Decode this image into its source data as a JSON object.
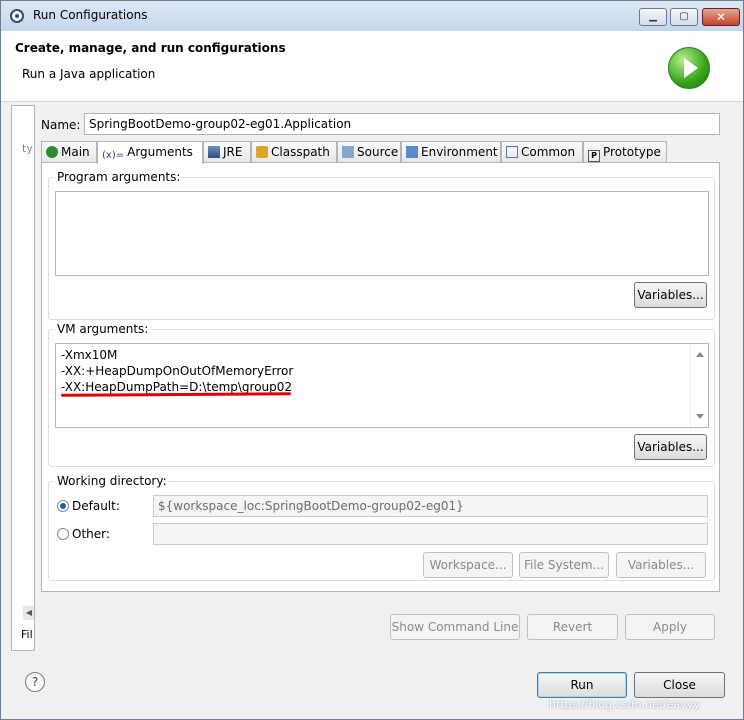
{
  "window": {
    "title": "Run Configurations"
  },
  "header": {
    "title": "Create, manage, and run configurations",
    "subtitle": "Run a Java application"
  },
  "left_panel": {
    "filter_text": "ty",
    "footer_text": "Fil"
  },
  "name": {
    "label": "Name:",
    "value": "SpringBootDemo-group02-eg01.Application"
  },
  "tabs": [
    {
      "label": "Main",
      "icon": "main-tab-icon"
    },
    {
      "label": "Arguments",
      "icon": "arguments-tab-icon",
      "active": true
    },
    {
      "label": "JRE",
      "icon": "jre-tab-icon"
    },
    {
      "label": "Classpath",
      "icon": "classpath-tab-icon"
    },
    {
      "label": "Source",
      "icon": "source-tab-icon"
    },
    {
      "label": "Environment",
      "icon": "environment-tab-icon"
    },
    {
      "label": "Common",
      "icon": "common-tab-icon"
    },
    {
      "label": "Prototype",
      "icon": "prototype-tab-icon"
    }
  ],
  "program_args": {
    "label": "Program arguments:",
    "value": "",
    "variables_button": "Variables..."
  },
  "vm_args": {
    "label": "VM arguments:",
    "lines": [
      "-Xmx10M",
      "-XX:+HeapDumpOnOutOfMemoryError",
      "-XX:HeapDumpPath=D:\\temp\\group02"
    ],
    "variables_button": "Variables..."
  },
  "working_dir": {
    "label": "Working directory:",
    "default_label": "Default:",
    "default_value": "${workspace_loc:SpringBootDemo-group02-eg01}",
    "other_label": "Other:",
    "other_value": "",
    "workspace_button": "Workspace...",
    "filesystem_button": "File System...",
    "variables_button": "Variables..."
  },
  "actions": {
    "show_command_line": "Show Command Line",
    "revert": "Revert",
    "apply": "Apply"
  },
  "footer": {
    "run": "Run",
    "close": "Close",
    "watermark": "https://blog.csdn.net/eayyy"
  },
  "colors": {
    "annotation_underline": "#e00000",
    "run_icon": "#35a21b"
  }
}
